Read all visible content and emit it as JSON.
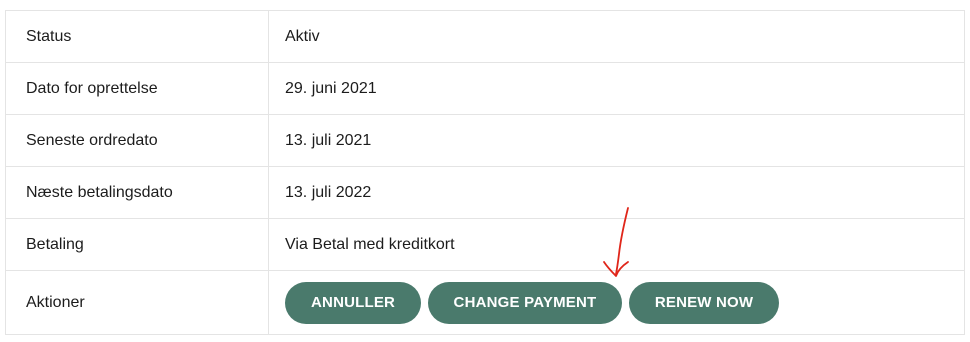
{
  "rows": [
    {
      "label": "Status",
      "value": "Aktiv"
    },
    {
      "label": "Dato for oprettelse",
      "value": "29. juni 2021"
    },
    {
      "label": "Seneste ordredato",
      "value": "13. juli 2021"
    },
    {
      "label": "Næste betalingsdato",
      "value": "13. juli 2022"
    },
    {
      "label": "Betaling",
      "value": "Via Betal med kreditkort"
    }
  ],
  "actions": {
    "label": "Aktioner",
    "buttons": {
      "cancel": "ANNULLER",
      "change_payment": "CHANGE PAYMENT",
      "renew_now": "RENEW NOW"
    }
  },
  "colors": {
    "button_bg": "#4a7a6c",
    "button_text": "#ffffff",
    "annotation_arrow": "#e0261a",
    "border": "#e4e4e4"
  },
  "annotation": {
    "icon": "red-arrow-down-icon"
  }
}
